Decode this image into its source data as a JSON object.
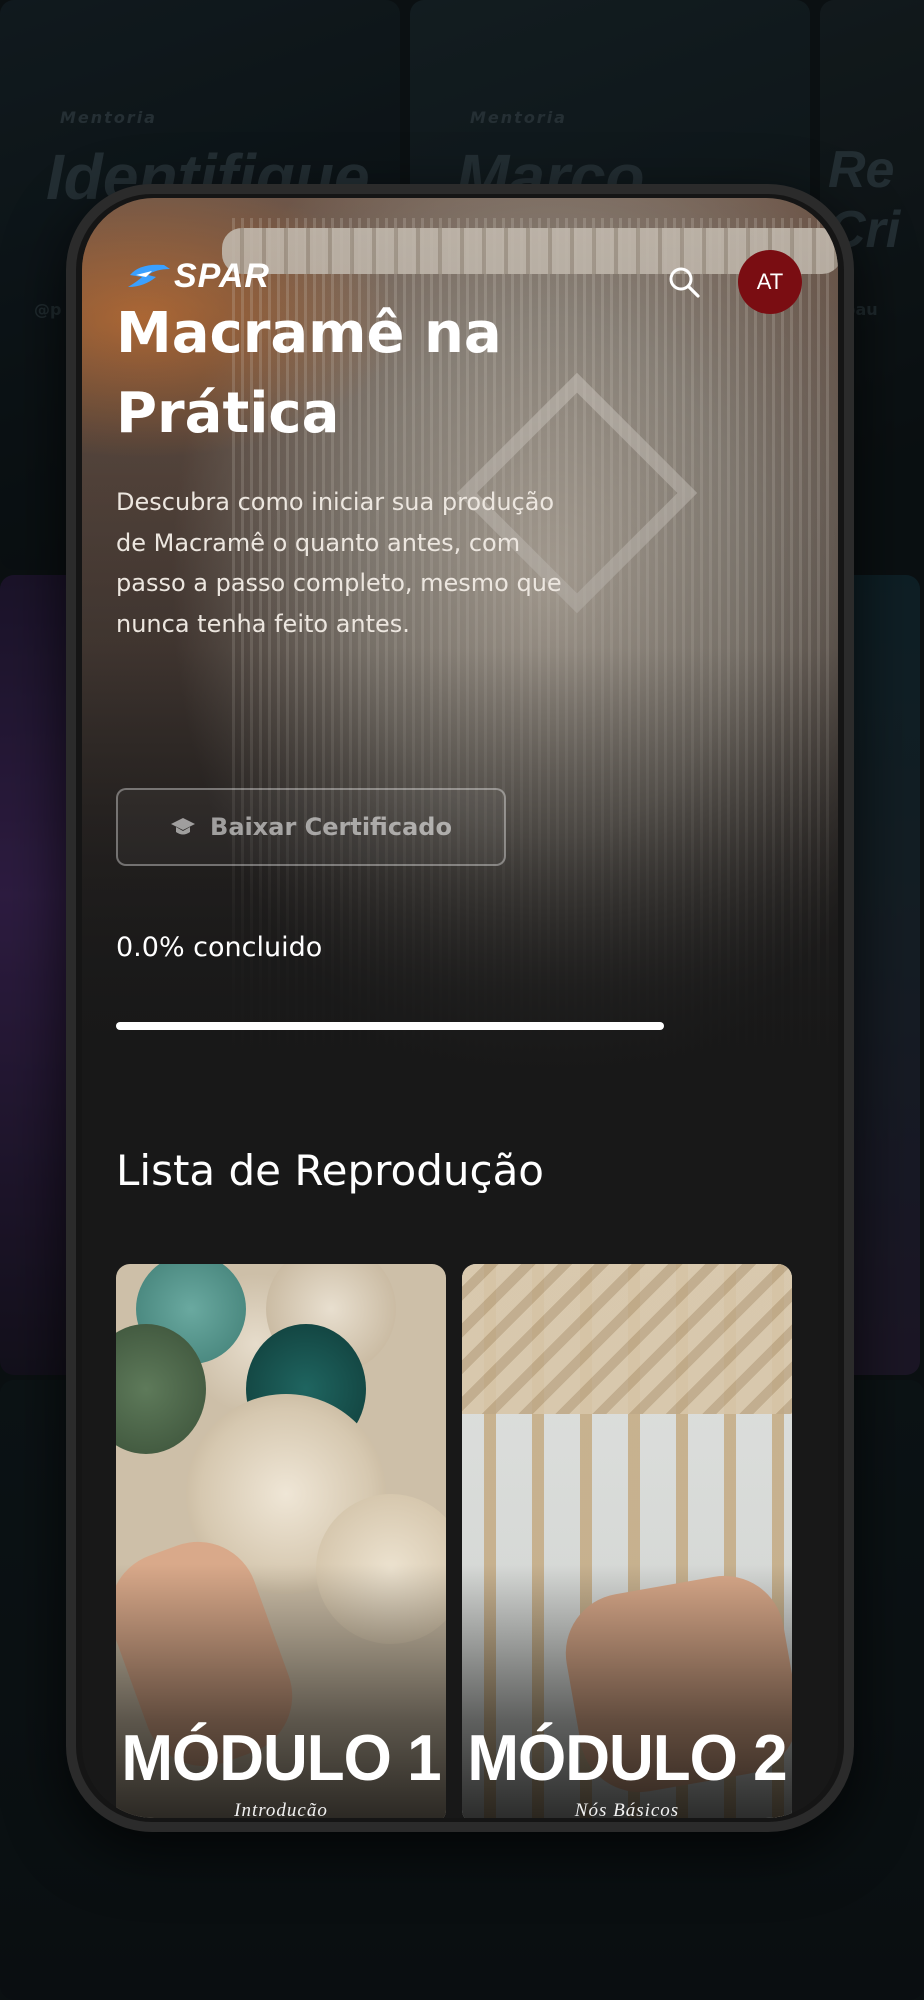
{
  "background": {
    "posters": [
      {
        "kicker": "Mentoria",
        "title": "Identifique",
        "handle": "@p"
      },
      {
        "kicker": "Mentoria",
        "title": "Marco",
        "handle": ""
      },
      {
        "kicker": "",
        "title": "Re Cri",
        "handle": "@pau"
      }
    ]
  },
  "header": {
    "logo_text": "SPAR",
    "search_icon": "search-icon",
    "avatar_initials": "AT",
    "avatar_color": "#7a0d12"
  },
  "course": {
    "title": "Macramê na Prática",
    "description": "Descubra como iniciar sua produção de Macramê o quanto antes, com passo a passo completo, mesmo que nunca tenha feito antes.",
    "certificate_button": "Baixar Certificado",
    "certificate_icon": "graduation-cap-icon",
    "progress_text": "0.0% concluido",
    "progress_percent": 0
  },
  "playlist": {
    "title": "Lista de Reprodução",
    "modules": [
      {
        "label": "MÓDULO 1",
        "subtitle": "Introducão"
      },
      {
        "label": "MÓDULO 2",
        "subtitle": "Nós Básicos"
      }
    ]
  },
  "colors": {
    "background": "#181818",
    "accent_avatar": "#7a0d12",
    "text": "#ffffff"
  }
}
